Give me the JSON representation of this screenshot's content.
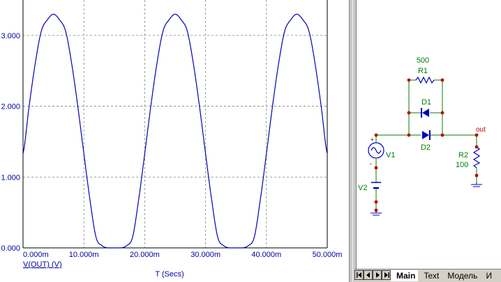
{
  "chart_data": {
    "type": "line",
    "xlabel": "T (Secs)",
    "ylabel": "",
    "trace_label": "V(OUT) (V)",
    "xlim": [
      0,
      0.05
    ],
    "ylim": [
      0,
      3.5
    ],
    "x_ticks": [
      "0.000m",
      "10.000m",
      "20.000m",
      "30.000m",
      "40.000m",
      "50.000m"
    ],
    "y_ticks": [
      "0.000",
      "1.000",
      "2.000",
      "3.000"
    ],
    "grid": true,
    "series": [
      {
        "name": "V(OUT) (V)",
        "color": "#0000b4",
        "x": [
          0,
          0.001,
          0.002,
          0.003,
          0.004,
          0.005,
          0.006,
          0.007,
          0.008,
          0.009,
          0.01,
          0.011,
          0.012,
          0.013,
          0.014,
          0.015,
          0.016,
          0.017,
          0.018,
          0.019,
          0.02,
          0.021,
          0.022,
          0.023,
          0.024,
          0.025,
          0.026,
          0.027,
          0.028,
          0.029,
          0.03,
          0.031,
          0.032,
          0.033,
          0.034,
          0.035,
          0.036,
          0.037,
          0.038,
          0.039,
          0.04,
          0.041,
          0.042,
          0.043,
          0.044,
          0.045,
          0.046,
          0.047,
          0.048,
          0.049,
          0.05
        ],
        "y": [
          1.33,
          2.0,
          2.6,
          3.06,
          3.22,
          3.3,
          3.22,
          3.06,
          2.6,
          2.0,
          1.33,
          0.68,
          0.15,
          0.03,
          0.0,
          0.0,
          0.0,
          0.03,
          0.15,
          0.68,
          1.33,
          2.0,
          2.6,
          3.06,
          3.22,
          3.3,
          3.22,
          3.06,
          2.6,
          2.0,
          1.33,
          0.68,
          0.15,
          0.03,
          0.0,
          0.0,
          0.0,
          0.03,
          0.15,
          0.68,
          1.33,
          2.0,
          2.6,
          3.06,
          3.22,
          3.3,
          3.22,
          3.06,
          2.6,
          2.0,
          1.33
        ]
      }
    ]
  },
  "schematic": {
    "r1_value": "500",
    "r1_name": "R1",
    "d1_name": "D1",
    "d2_name": "D2",
    "v1_name": "V1",
    "v2_name": "V2",
    "r2_name": "R2",
    "r2_value": "100",
    "out_label": "out",
    "plus_sign": "+",
    "minus_sign": "-",
    "wire_color": "#008000",
    "node_color": "#c00000",
    "component_color": "#0000c0"
  },
  "tabs": [
    {
      "label": "Main",
      "active": true
    },
    {
      "label": "Text",
      "active": false
    },
    {
      "label": "Модель",
      "active": false
    },
    {
      "label": "И",
      "active": false
    }
  ],
  "nav_icons": [
    "first-page-icon",
    "prev-page-icon",
    "next-page-icon",
    "last-page-icon"
  ]
}
